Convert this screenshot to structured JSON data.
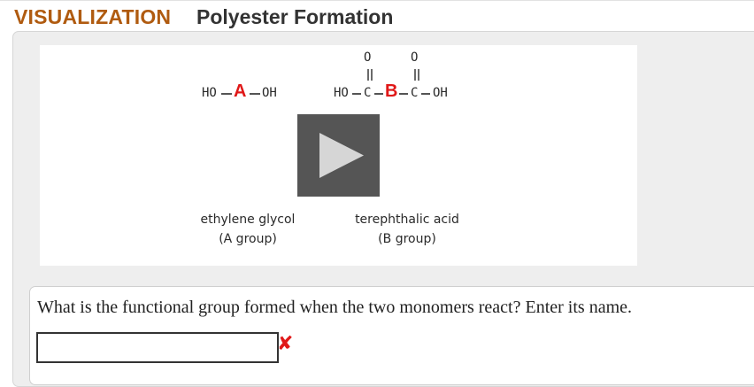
{
  "header": {
    "tag": "VISUALIZATION",
    "title": "Polyester Formation"
  },
  "media": {
    "monomer_a": {
      "left": "HO",
      "group": "A",
      "right": "OH",
      "name_line1": "ethylene glycol",
      "name_line2": "(A group)"
    },
    "monomer_b": {
      "left": "HO",
      "c1": "C",
      "group": "B",
      "c2": "C",
      "right": "OH",
      "oxygen": "O",
      "name_line1": "terephthalic acid",
      "name_line2": "(B group)"
    },
    "play_icon": "play-icon"
  },
  "question": {
    "text": "What is the functional group formed when the two monomers react? Enter its name.",
    "answer_value": "",
    "status_icon": "incorrect-x-icon",
    "status_mark": "✘"
  },
  "colors": {
    "tag": "#b05b10",
    "group_letters": "#e01818",
    "play_button": "#555555"
  }
}
